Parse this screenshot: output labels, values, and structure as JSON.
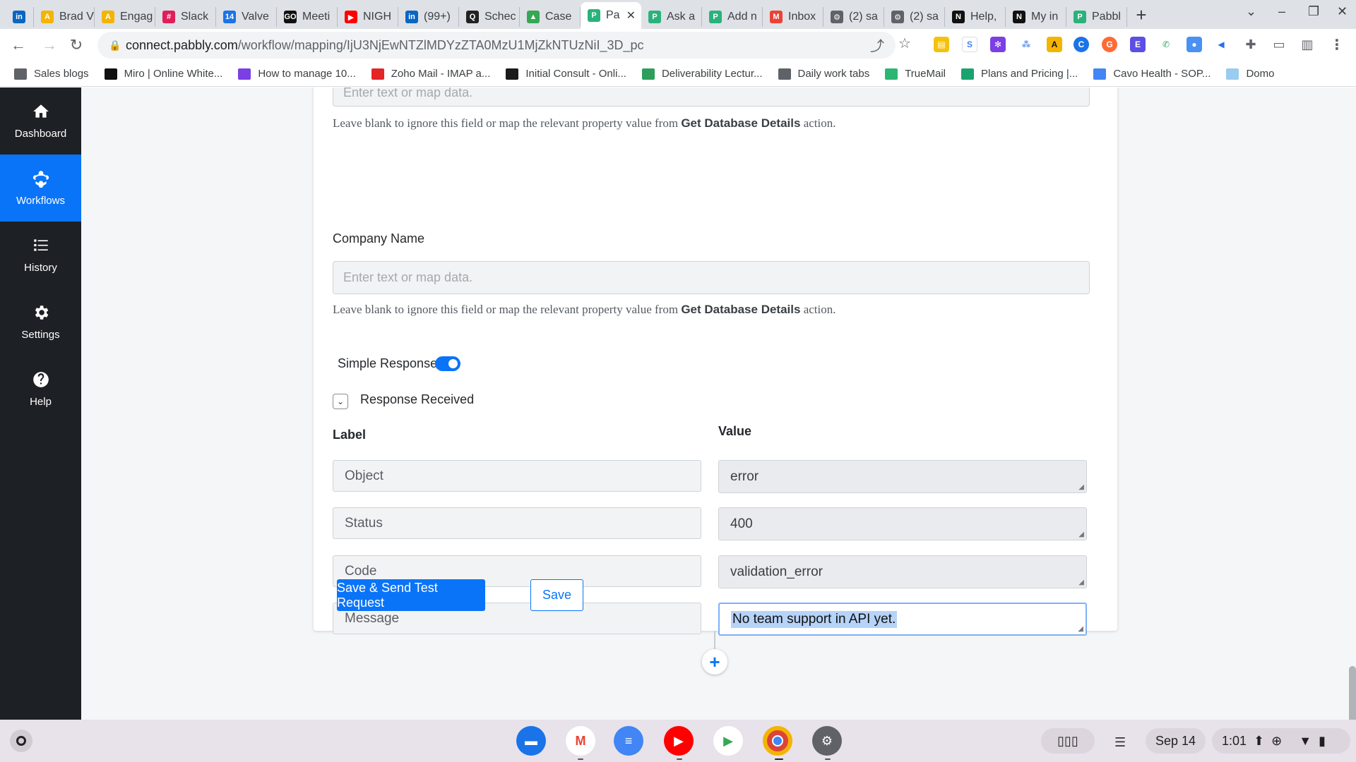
{
  "browser": {
    "tabs": [
      {
        "title": "",
        "icon": "linkedin-icon",
        "color": "#0a66c2",
        "glyph": "in"
      },
      {
        "title": "Brad V",
        "icon": "awaken-icon",
        "color": "#f4b400",
        "glyph": "A"
      },
      {
        "title": "Engag",
        "icon": "awaken-icon",
        "color": "#f4b400",
        "glyph": "A"
      },
      {
        "title": "Slack",
        "icon": "slack-icon",
        "color": "#e01e5a",
        "glyph": "#"
      },
      {
        "title": "Valve",
        "icon": "calendar-icon",
        "color": "#1a73e8",
        "glyph": "14"
      },
      {
        "title": "Meeti",
        "icon": "meeting-icon",
        "color": "#111111",
        "glyph": "GO"
      },
      {
        "title": "NIGH",
        "icon": "youtube-icon",
        "color": "#ff0000",
        "glyph": "▶"
      },
      {
        "title": "(99+)",
        "icon": "linkedin-icon",
        "color": "#0a66c2",
        "glyph": "in"
      },
      {
        "title": "Schec",
        "icon": "schedule-icon",
        "color": "#222222",
        "glyph": "Q"
      },
      {
        "title": "Case",
        "icon": "drive-icon",
        "color": "#34a853",
        "glyph": "▲"
      },
      {
        "title": "Pa",
        "icon": "pabbly-icon",
        "color": "#2ab27b",
        "glyph": "P",
        "active": true
      },
      {
        "title": "Ask a",
        "icon": "pabbly-icon",
        "color": "#2ab27b",
        "glyph": "P"
      },
      {
        "title": "Add n",
        "icon": "pabbly-icon",
        "color": "#2ab27b",
        "glyph": "P"
      },
      {
        "title": "Inbox",
        "icon": "gmail-icon",
        "color": "#ea4335",
        "glyph": "M"
      },
      {
        "title": "(2) sa",
        "icon": "gear-icon",
        "color": "#5f6368",
        "glyph": "⚙"
      },
      {
        "title": "(2) sa",
        "icon": "gear-icon",
        "color": "#5f6368",
        "glyph": "⚙"
      },
      {
        "title": "Help,",
        "icon": "notion-icon",
        "color": "#111111",
        "glyph": "N"
      },
      {
        "title": "My in",
        "icon": "notion-icon",
        "color": "#111111",
        "glyph": "N"
      },
      {
        "title": "Pabbl",
        "icon": "pabbly-icon",
        "color": "#2ab27b",
        "glyph": "P"
      }
    ],
    "url_host": "connect.pabbly.com",
    "url_path": "/workflow/mapping/IjU3NjEwNTZlMDYzZTA0MzU1MjZkNTUzNiI_3D_pc",
    "bookmarks": [
      {
        "label": "Sales blogs",
        "icon": "folder-icon",
        "color": "#5f6368"
      },
      {
        "label": "Miro | Online White...",
        "icon": "miro-icon",
        "color": "#111111"
      },
      {
        "label": "How to manage 10...",
        "icon": "snowflake-icon",
        "color": "#7b3fe4"
      },
      {
        "label": "Zoho Mail - IMAP a...",
        "icon": "zoho-icon",
        "color": "#e42527"
      },
      {
        "label": "Initial Consult - Onli...",
        "icon": "check-icon",
        "color": "#1a1a1a"
      },
      {
        "label": "Deliverability Lectur...",
        "icon": "course-icon",
        "color": "#2e9e5b"
      },
      {
        "label": "Daily work tabs",
        "icon": "folder-icon",
        "color": "#5f6368"
      },
      {
        "label": "TrueMail",
        "icon": "truemail-icon",
        "color": "#2bb673"
      },
      {
        "label": "Plans and Pricing |...",
        "icon": "checkmark-icon",
        "color": "#1aa36f"
      },
      {
        "label": "Cavo Health - SOP...",
        "icon": "docs-icon",
        "color": "#4285f4"
      },
      {
        "label": "Domo",
        "icon": "domo-icon",
        "color": "#99ccee"
      }
    ]
  },
  "sidebar": {
    "items": [
      {
        "label": "Dashboard",
        "icon": "home-icon"
      },
      {
        "label": "Workflows",
        "icon": "workflow-icon",
        "active": true
      },
      {
        "label": "History",
        "icon": "history-icon"
      },
      {
        "label": "Settings",
        "icon": "gear-icon"
      },
      {
        "label": "Help",
        "icon": "help-icon"
      }
    ]
  },
  "form": {
    "top_field_placeholder": "Enter text or map data.",
    "top_help_prefix": "Leave blank to ignore this field or map the relevant property value from ",
    "top_help_bold": "Get Database Details",
    "top_help_suffix": " action.",
    "company_label": "Company Name",
    "company_placeholder": "Enter text or map data.",
    "company_help_prefix": "Leave blank to ignore this field or map the relevant property value from ",
    "company_help_bold": "Get Database Details",
    "company_help_suffix": " action.",
    "simple_response_label": "Simple Response",
    "simple_response_on": true,
    "response_received_label": "Response Received",
    "col_label": "Label",
    "col_value": "Value",
    "rows": [
      {
        "label": "Object",
        "value": "error"
      },
      {
        "label": "Status",
        "value": "400"
      },
      {
        "label": "Code",
        "value": "validation_error"
      },
      {
        "label": "Message",
        "value": "No team support in API yet."
      }
    ],
    "save_send_label": "Save & Send Test Request",
    "save_label": "Save",
    "add_step_label": "+"
  },
  "shelf": {
    "date": "Sep 14",
    "time": "1:01"
  },
  "colors": {
    "accent": "#0a74f8",
    "sidebar_bg": "#1d2024"
  }
}
